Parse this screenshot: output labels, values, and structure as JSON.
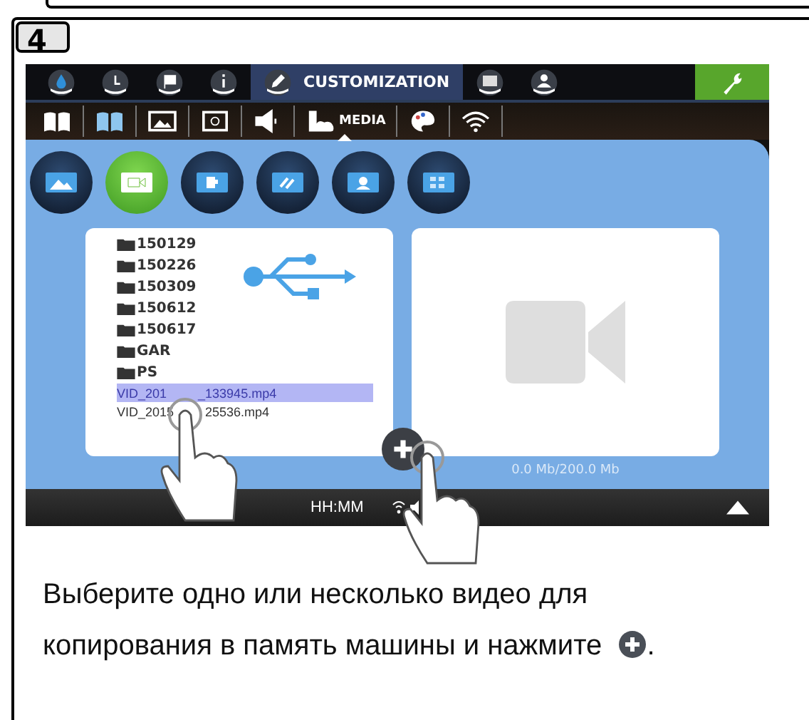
{
  "step": "4",
  "top_tabs": [
    {
      "selected": false
    },
    {
      "selected": false
    },
    {
      "selected": false
    },
    {
      "selected": false
    },
    {
      "label": "CUSTOMIZATION",
      "selected": true
    },
    {
      "selected": false
    },
    {
      "selected": false
    }
  ],
  "sub_tabs": [
    {
      "selected": false
    },
    {
      "selected": false
    },
    {
      "selected": false
    },
    {
      "selected": false
    },
    {
      "selected": false
    },
    {
      "label": "MEDIA",
      "selected": true
    },
    {
      "selected": false
    },
    {
      "selected": false
    }
  ],
  "media_types": [
    {
      "selected": false
    },
    {
      "selected": true
    },
    {
      "selected": false
    },
    {
      "selected": false
    },
    {
      "selected": false
    },
    {
      "selected": false
    }
  ],
  "files": [
    {
      "kind": "folder",
      "name": "150129"
    },
    {
      "kind": "folder",
      "name": "150226"
    },
    {
      "kind": "folder",
      "name": "150309"
    },
    {
      "kind": "folder",
      "name": "150612"
    },
    {
      "kind": "folder",
      "name": "150617"
    },
    {
      "kind": "folder",
      "name": "GAR"
    },
    {
      "kind": "folder",
      "name": "PS"
    },
    {
      "kind": "video",
      "name_start": "VID_201",
      "name_end": "_133945.mp4",
      "selected": true
    },
    {
      "kind": "video",
      "name_start": "VID_2015",
      "name_end": "25536.mp4",
      "selected": false
    }
  ],
  "storage": "0.0 Mb/200.0 Mb",
  "clock": "HH:MM",
  "instruction": "Выберите одно или несколько видео для копирования в память машины и нажмите",
  "instruction_end": "."
}
